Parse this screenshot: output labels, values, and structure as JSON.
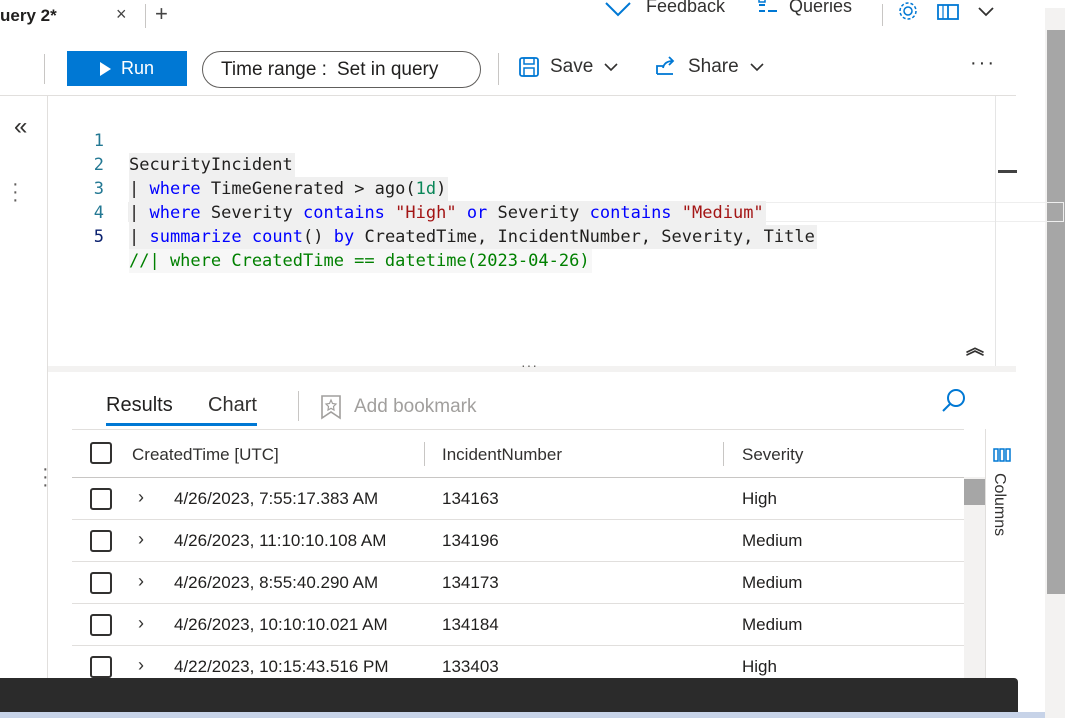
{
  "tabs": {
    "active_title": "uery 2*",
    "close_glyph": "×",
    "add_glyph": "+"
  },
  "top_actions": {
    "feedback_label": "Feedback",
    "queries_label": "Queries"
  },
  "toolbar": {
    "run_label": "Run",
    "time_range_label": "Time range :",
    "time_range_value": "Set in query",
    "save_label": "Save",
    "share_label": "Share",
    "more_label": "···"
  },
  "editor": {
    "lines": [
      {
        "number": "1"
      },
      {
        "number": "2"
      },
      {
        "number": "3"
      },
      {
        "number": "4"
      },
      {
        "number": "5"
      }
    ],
    "tokens": {
      "l1_table": "SecurityIncident",
      "l2_pipe": "| ",
      "l2_kw": "where",
      "l2_rest": " TimeGenerated > ago(",
      "l2_num": "1d",
      "l2_close": ")",
      "l3_pipe": "| ",
      "l3_kw1": "where",
      "l3_a": " Severity ",
      "l3_kw2": "contains",
      "l3_str1": " \"High\"",
      "l3_kw3": " or",
      "l3_b": " Severity ",
      "l3_kw4": "contains",
      "l3_str2": " \"Medium\"",
      "l4_pipe": "| ",
      "l4_kw1": "summarize",
      "l4_kw2": " count",
      "l4_a": "() ",
      "l4_kw3": "by",
      "l4_rest": " CreatedTime, IncidentNumber, Severity, Title",
      "l5_comment": "//| where CreatedTime == datetime(2023-04-26)"
    }
  },
  "results": {
    "tab_results": "Results",
    "tab_chart": "Chart",
    "add_bookmark": "Add bookmark",
    "columns_label": "Columns",
    "headers": [
      "CreatedTime [UTC]",
      "IncidentNumber",
      "Severity"
    ],
    "rows": [
      {
        "created": "4/26/2023, 7:55:17.383 AM",
        "incident": "134163",
        "severity": "High"
      },
      {
        "created": "4/26/2023, 11:10:10.108 AM",
        "incident": "134196",
        "severity": "Medium"
      },
      {
        "created": "4/26/2023, 8:55:40.290 AM",
        "incident": "134173",
        "severity": "Medium"
      },
      {
        "created": "4/26/2023, 10:10:10.021 AM",
        "incident": "134184",
        "severity": "Medium"
      },
      {
        "created": "4/22/2023, 10:15:43.516 PM",
        "incident": "133403",
        "severity": "High"
      }
    ]
  },
  "colors": {
    "accent": "#0078d4",
    "keyword": "#0000ff",
    "string": "#a31515",
    "comment": "#008000",
    "number": "#098658"
  }
}
